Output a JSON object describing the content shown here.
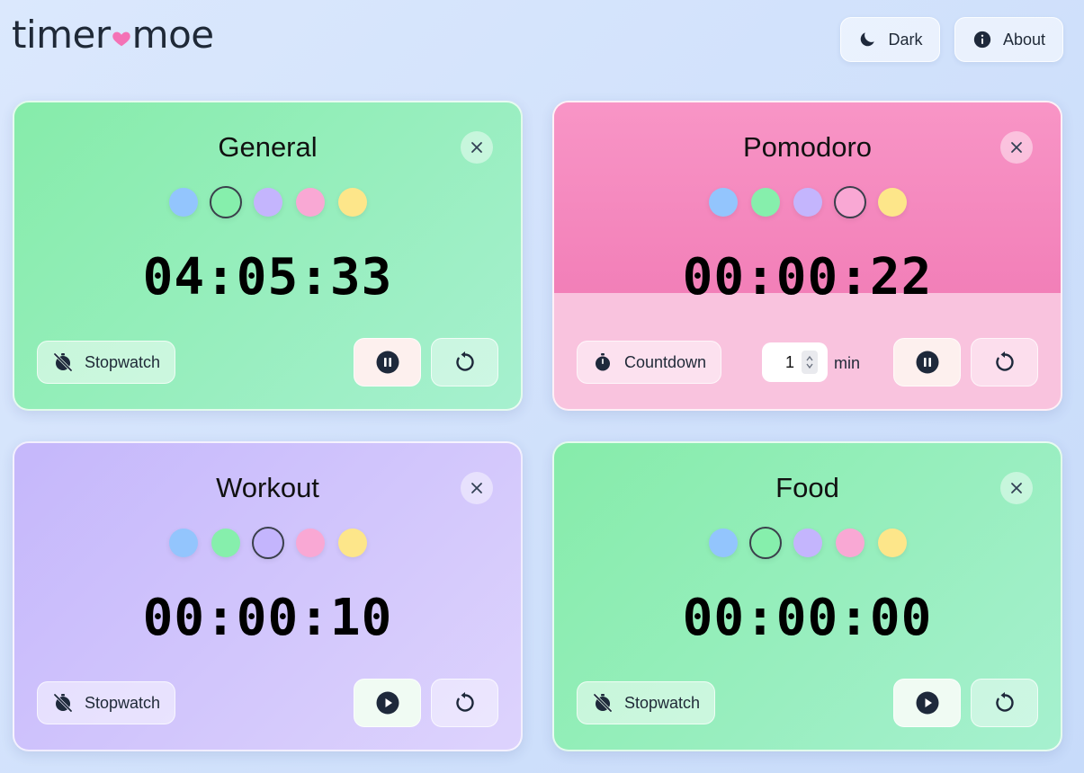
{
  "app": {
    "logo_left": "timer",
    "logo_right": "moe",
    "buttons": {
      "dark_label": "Dark",
      "about_label": "About"
    }
  },
  "swatch_colors": [
    "#93c5fd",
    "#86efac",
    "#c4b5fd",
    "#f9a8d4",
    "#fde68a"
  ],
  "timers": [
    {
      "title": "General",
      "time": "04:05:33",
      "mode_label": "Stopwatch",
      "selected_color": 1,
      "state": "running",
      "theme": "green"
    },
    {
      "title": "Pomodoro",
      "time": "00:00:22",
      "mode_label": "Countdown",
      "minutes_value": "1",
      "minutes_unit": "min",
      "selected_color": 3,
      "state": "running",
      "theme": "pink"
    },
    {
      "title": "Workout",
      "time": "00:00:10",
      "mode_label": "Stopwatch",
      "selected_color": 2,
      "state": "paused",
      "theme": "purple"
    },
    {
      "title": "Food",
      "time": "00:00:00",
      "mode_label": "Stopwatch",
      "selected_color": 1,
      "state": "paused",
      "theme": "green"
    }
  ]
}
